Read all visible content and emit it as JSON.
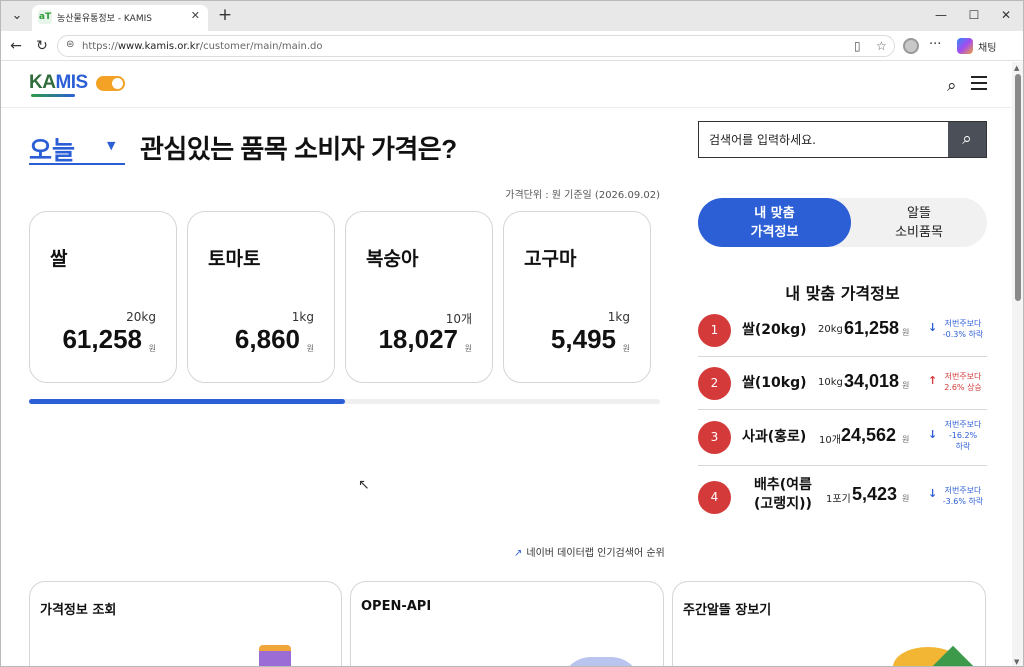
{
  "browser": {
    "tab_title": "농산물유통정보 - KAMIS",
    "favicon_text": "aT",
    "url_prefix": "https://",
    "url_domain": "www.kamis.or.kr",
    "url_path": "/customer/main/main.do",
    "chat_label": "채팅"
  },
  "header": {
    "logo_part1": "KA",
    "logo_part2": "MIS"
  },
  "hero": {
    "period_value": "오늘",
    "headline": "관심있는 품목 소비자 가격은?",
    "search_placeholder": "검색어를 입력하세요.",
    "price_info": "가격단위 : 원   기준일 (2026.09.02)"
  },
  "cards": [
    {
      "name": "쌀",
      "unit": "20kg",
      "price": "61,258",
      "won": "원"
    },
    {
      "name": "토마토",
      "unit": "1kg",
      "price": "6,860",
      "won": "원"
    },
    {
      "name": "복숭아",
      "unit": "10개",
      "price": "18,027",
      "won": "원"
    },
    {
      "name": "고구마",
      "unit": "1kg",
      "price": "5,495",
      "won": "원"
    }
  ],
  "carousel_progress": 0.5,
  "naver_link": "네이버 데이터랩 인기검색어 순위",
  "side": {
    "seg_active_line1": "내 맞춤",
    "seg_active_line2": "가격정보",
    "seg_inactive_line1": "알뜰",
    "seg_inactive_line2": "소비품목",
    "rank_title": "내 맞춤 가격정보",
    "ranks": [
      {
        "num": "1",
        "name": "쌀(20kg)",
        "unit": "20kg",
        "price": "61,258",
        "won": "원",
        "dir": "down",
        "change_l1": "저번주보다",
        "change_l2": "-0.3% 하락",
        "change_l3": ""
      },
      {
        "num": "2",
        "name": "쌀(10kg)",
        "unit": "10kg",
        "price": "34,018",
        "won": "원",
        "dir": "up",
        "change_l1": "저번주보다",
        "change_l2": "2.6% 상승",
        "change_l3": ""
      },
      {
        "num": "3",
        "name": "사과(홍로)",
        "unit": "10개",
        "price": "24,562",
        "won": "원",
        "dir": "down",
        "change_l1": "저번주보다",
        "change_l2": "-16.2%",
        "change_l3": "하락"
      },
      {
        "num": "4",
        "name": "배추(여름",
        "name2": "(고랭지))",
        "unit": "1포기",
        "price": "5,423",
        "won": "원",
        "dir": "down",
        "change_l1": "저번주보다",
        "change_l2": "-3.6% 하락",
        "change_l3": ""
      }
    ]
  },
  "bottom_cards": [
    {
      "title": "가격정보 조회"
    },
    {
      "title": "OPEN-API"
    },
    {
      "title": "주간알뜰 장보기"
    }
  ],
  "icons": {
    "tab_dropdown": "chevron-down-icon",
    "new_tab": "plus-icon",
    "back": "back-arrow-icon",
    "reload": "reload-icon",
    "search": "search-icon",
    "menu": "hamburger-icon",
    "trend": "trend-up-icon"
  },
  "colors": {
    "accent": "#2c5fd6",
    "rank_badge": "#d43a3a",
    "logo_green": "#2f6b3b",
    "toggle": "#f3a226"
  }
}
